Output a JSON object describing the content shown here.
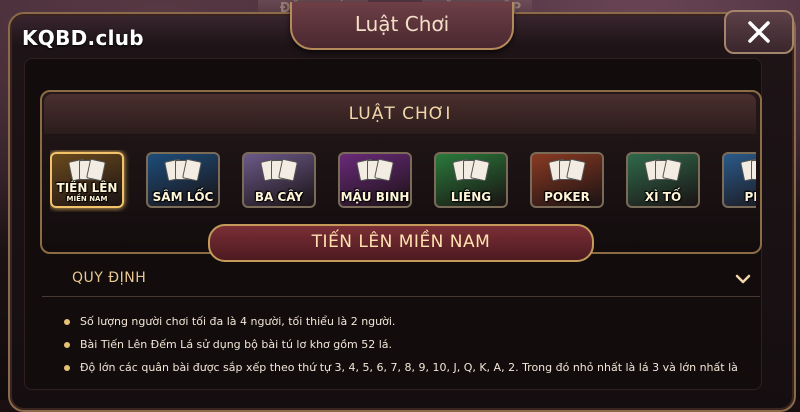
{
  "background": {
    "tabs": [
      "ĐĂNG KÝ",
      "ĐĂNG NHẬP"
    ]
  },
  "brand": {
    "name": "KQBD.club"
  },
  "dialog": {
    "title": "Luật Chơi",
    "close_icon": "close-x-icon"
  },
  "panel": {
    "header": "LUẬT CHƠI",
    "games": [
      {
        "label": "TIẾN LÊN",
        "sub": "MIỀN NAM",
        "color": "#6a4a1c",
        "selected": true
      },
      {
        "label": "SÂM LỐC",
        "sub": "",
        "color": "#1d4d7a",
        "selected": false
      },
      {
        "label": "BA CÂY",
        "sub": "",
        "color": "#6c5a8a",
        "selected": false
      },
      {
        "label": "MẬU BINH",
        "sub": "",
        "color": "#6a2a7a",
        "selected": false
      },
      {
        "label": "LIÊNG",
        "sub": "",
        "color": "#2a7a3a",
        "selected": false
      },
      {
        "label": "POKER",
        "sub": "",
        "color": "#8a3a22",
        "selected": false
      },
      {
        "label": "XÌ TỐ",
        "sub": "",
        "color": "#2f6a4a",
        "selected": false
      },
      {
        "label": "PHỎ",
        "sub": "",
        "color": "#2a5a8a",
        "selected": false
      }
    ]
  },
  "selected_game_title": "TIẾN LÊN MIỀN NAM",
  "rules": {
    "title": "QUY ĐỊNH",
    "items": [
      "Số lượng người chơi tối đa là 4 người, tối thiểu là 2 người.",
      "Bài Tiến Lên Đếm Lá sử dụng bộ bài tú lơ khơ gồm 52 lá.",
      "Độ lớn các quân bài được sắp xếp theo thứ tự 3, 4, 5, 6, 7, 8, 9, 10, J, Q, K, A, 2. Trong đó nhỏ nhất là lá 3 và lớn nhất là"
    ]
  },
  "colors": {
    "gold": "#c49a5a",
    "accent_text": "#f0d6a8"
  }
}
